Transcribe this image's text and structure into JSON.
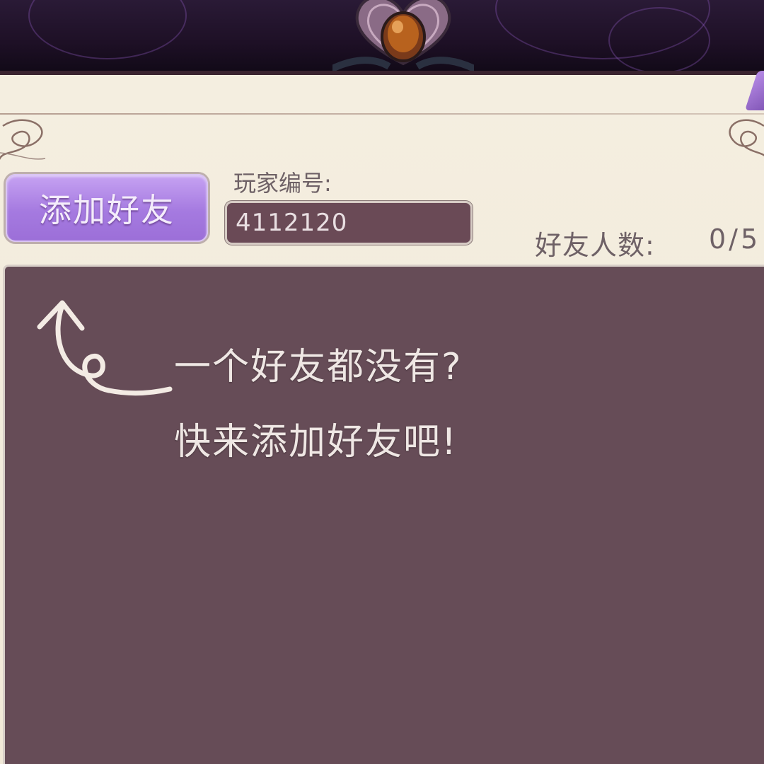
{
  "friends_panel": {
    "add_friend_button_label": "添加好友",
    "player_id_label": "玩家编号:",
    "player_id_value": "4112120",
    "friend_count_label": "好友人数:",
    "friend_count_value": "0/5",
    "empty_hint_line1": "一个好友都没有?",
    "empty_hint_line2": "快来添加好友吧!"
  },
  "colors": {
    "accent_purple": "#a57ae0",
    "panel_cream": "#f4eee0",
    "list_background": "#664c57",
    "text_muted": "#6e6166"
  },
  "icons": {
    "top_ornament": "jeweled-heart-ornament-icon",
    "hint_arrow": "curly-arrow-up-icon"
  }
}
